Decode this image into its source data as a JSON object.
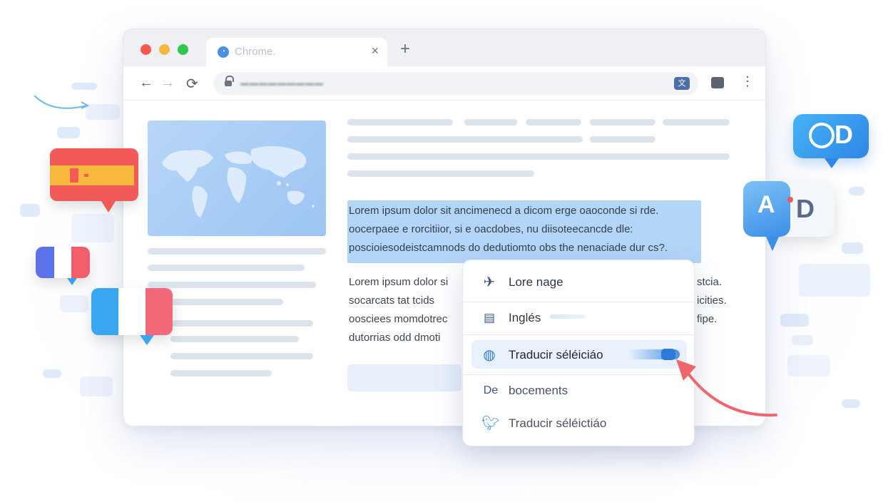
{
  "browser": {
    "tab_title": "Chrome.",
    "tab_close": "×",
    "new_tab": "+",
    "nav_back": "←",
    "nav_forward": "→",
    "nav_reload": "⟳",
    "menu": "⋮",
    "url": "▬▬▬▬▬▬▬▬▬"
  },
  "article": {
    "selected_lines": [
      "Lorem ipsum dolor sit ancimenecd a dicom erge oaoconde si rde.",
      "oocerpaee e rorcitiior, si e oacdobes, nu diisoteecancde dle:",
      "poscioiesodeistcamnods do dedutiomto obs the nenaciade dur cs?."
    ],
    "plain_lines": [
      "Lorem ipsum dolor si",
      "socarcats tat tcids",
      "oosciees momdotrec",
      "dutorrias odd dmoti"
    ],
    "plain_tails": [
      "stcia.",
      "icities.",
      "",
      "fipe."
    ]
  },
  "context_menu": {
    "items": [
      {
        "icon": "plane-icon",
        "label": "Lore nage"
      },
      {
        "icon": "document-icon",
        "label": "Inglés"
      },
      {
        "icon": "globe-icon",
        "label": "Traducir séléiciáo"
      },
      {
        "icon": "de-text-icon",
        "label": "bocements",
        "icon_text": "De"
      },
      {
        "icon": "bird-icon",
        "label": "Traducir séléictiáo"
      }
    ],
    "active_index": 2
  },
  "badges": {
    "top_right": "D",
    "mid_right_a": "A",
    "mid_right_d": "D"
  },
  "colors": {
    "dot_red": "#f45b4f",
    "dot_yellow": "#f6b83c",
    "dot_green": "#2ec84a",
    "accent": "#4a90e2",
    "arrow": "#f0646c"
  }
}
